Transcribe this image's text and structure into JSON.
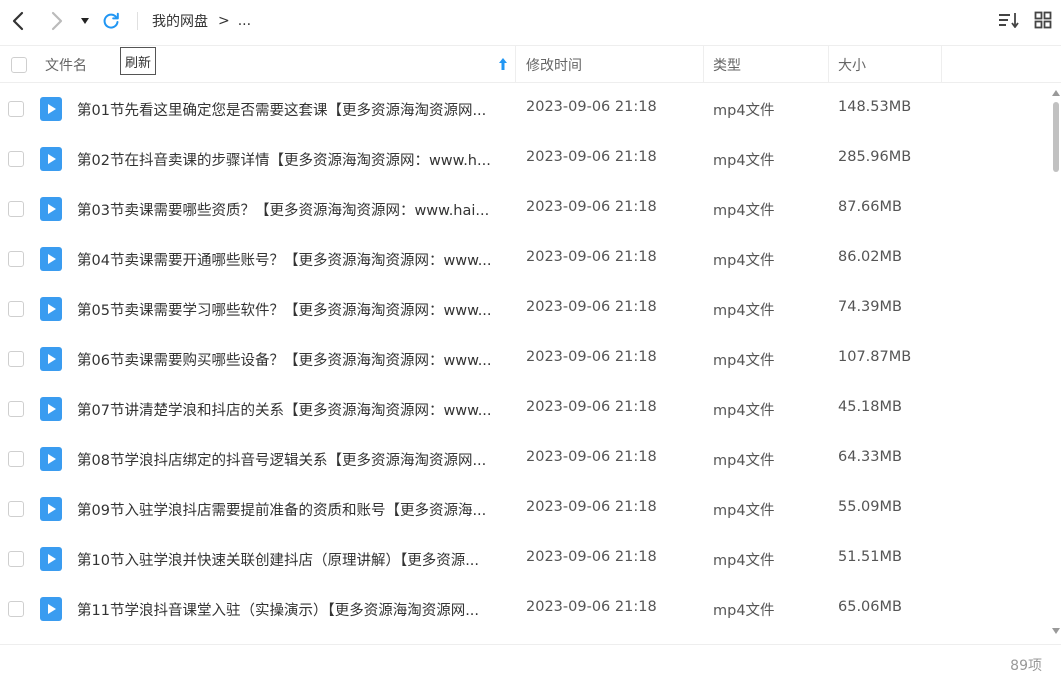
{
  "toolbar": {
    "back_icon": "chevron-left-icon",
    "forward_icon": "chevron-right-icon",
    "dropdown_icon": "caret-down-icon",
    "refresh_icon": "refresh-icon",
    "refresh_tooltip": "刷新",
    "sort_icon": "sort-icon",
    "grid_icon": "grid-view-icon"
  },
  "breadcrumb": {
    "root": "我的网盘",
    "separator": ">",
    "ellipsis": "..."
  },
  "columns": {
    "name": "文件名",
    "modified": "修改时间",
    "type": "类型",
    "size": "大小"
  },
  "files": [
    {
      "name": "第01节先看这里确定您是否需要这套课【更多资源海淘资源网...",
      "modified": "2023-09-06 21:18",
      "type": "mp4文件",
      "size": "148.53MB"
    },
    {
      "name": "第02节在抖音卖课的步骤详情【更多资源海淘资源网：www.h...",
      "modified": "2023-09-06 21:18",
      "type": "mp4文件",
      "size": "285.96MB"
    },
    {
      "name": "第03节卖课需要哪些资质？【更多资源海淘资源网：www.hai...",
      "modified": "2023-09-06 21:18",
      "type": "mp4文件",
      "size": "87.66MB"
    },
    {
      "name": "第04节卖课需要开通哪些账号？【更多资源海淘资源网：www...",
      "modified": "2023-09-06 21:18",
      "type": "mp4文件",
      "size": "86.02MB"
    },
    {
      "name": "第05节卖课需要学习哪些软件？【更多资源海淘资源网：www...",
      "modified": "2023-09-06 21:18",
      "type": "mp4文件",
      "size": "74.39MB"
    },
    {
      "name": "第06节卖课需要购买哪些设备？【更多资源海淘资源网：www...",
      "modified": "2023-09-06 21:18",
      "type": "mp4文件",
      "size": "107.87MB"
    },
    {
      "name": "第07节讲清楚学浪和抖店的关系【更多资源海淘资源网：www...",
      "modified": "2023-09-06 21:18",
      "type": "mp4文件",
      "size": "45.18MB"
    },
    {
      "name": "第08节学浪抖店绑定的抖音号逻辑关系【更多资源海淘资源网...",
      "modified": "2023-09-06 21:18",
      "type": "mp4文件",
      "size": "64.33MB"
    },
    {
      "name": "第09节入驻学浪抖店需要提前准备的资质和账号【更多资源海...",
      "modified": "2023-09-06 21:18",
      "type": "mp4文件",
      "size": "55.09MB"
    },
    {
      "name": "第10节入驻学浪并快速关联创建抖店（原理讲解）【更多资源...",
      "modified": "2023-09-06 21:18",
      "type": "mp4文件",
      "size": "51.51MB"
    },
    {
      "name": "第11节学浪抖音课堂入驻（实操演示）【更多资源海淘资源网...",
      "modified": "2023-09-06 21:18",
      "type": "mp4文件",
      "size": "65.06MB"
    }
  ],
  "file_icon": "video-file-icon",
  "footer": {
    "count": "89项"
  },
  "colors": {
    "accent": "#2196f3",
    "file_icon": "#3a9cf0"
  }
}
